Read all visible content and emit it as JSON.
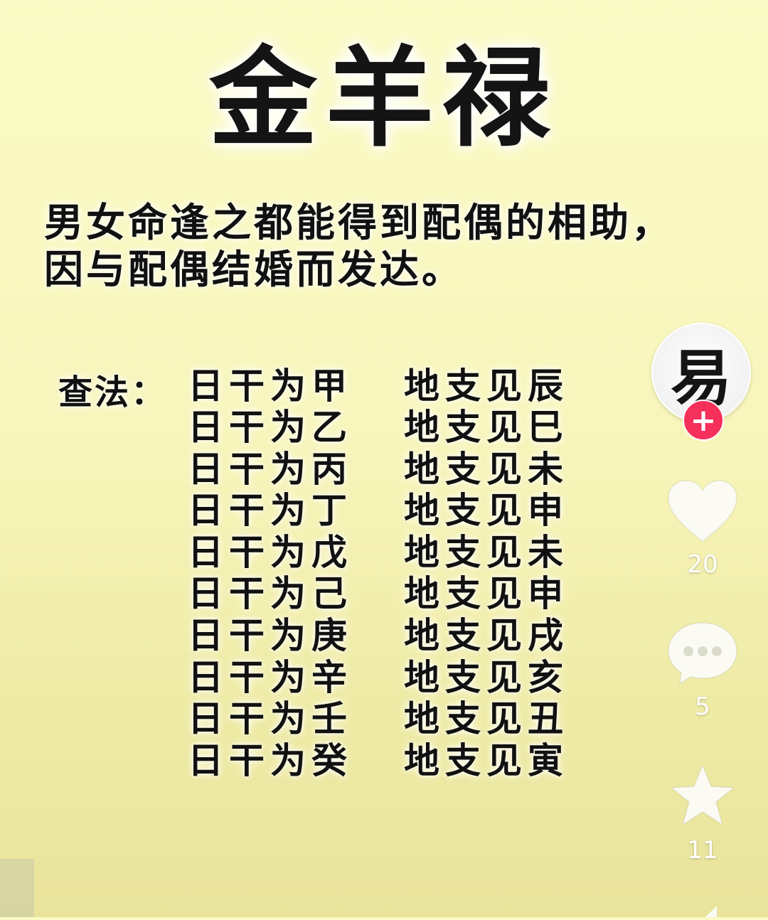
{
  "title": "金羊禄",
  "description": {
    "line1": "男女命逢之都能得到配偶的相助，",
    "line2": "因与配偶结婚而发达。"
  },
  "method": {
    "label": "查法：",
    "rows": [
      {
        "stem": "日干为甲",
        "branch": "地支见辰"
      },
      {
        "stem": "日干为乙",
        "branch": "地支见巳"
      },
      {
        "stem": "日干为丙",
        "branch": "地支见未"
      },
      {
        "stem": "日干为丁",
        "branch": "地支见申"
      },
      {
        "stem": "日干为戊",
        "branch": "地支见未"
      },
      {
        "stem": "日干为己",
        "branch": "地支见申"
      },
      {
        "stem": "日干为庚",
        "branch": "地支见戌"
      },
      {
        "stem": "日干为辛",
        "branch": "地支见亥"
      },
      {
        "stem": "日干为壬",
        "branch": "地支见丑"
      },
      {
        "stem": "日干为癸",
        "branch": "地支见寅"
      }
    ]
  },
  "sidebar": {
    "avatar_glyph": "易",
    "follow_label": "+",
    "like_count": "20",
    "comment_count": "5",
    "favorite_count": "11",
    "icons": [
      "heart-icon",
      "comment-icon",
      "star-icon",
      "share-icon"
    ],
    "accent_color": "#f5305a"
  }
}
